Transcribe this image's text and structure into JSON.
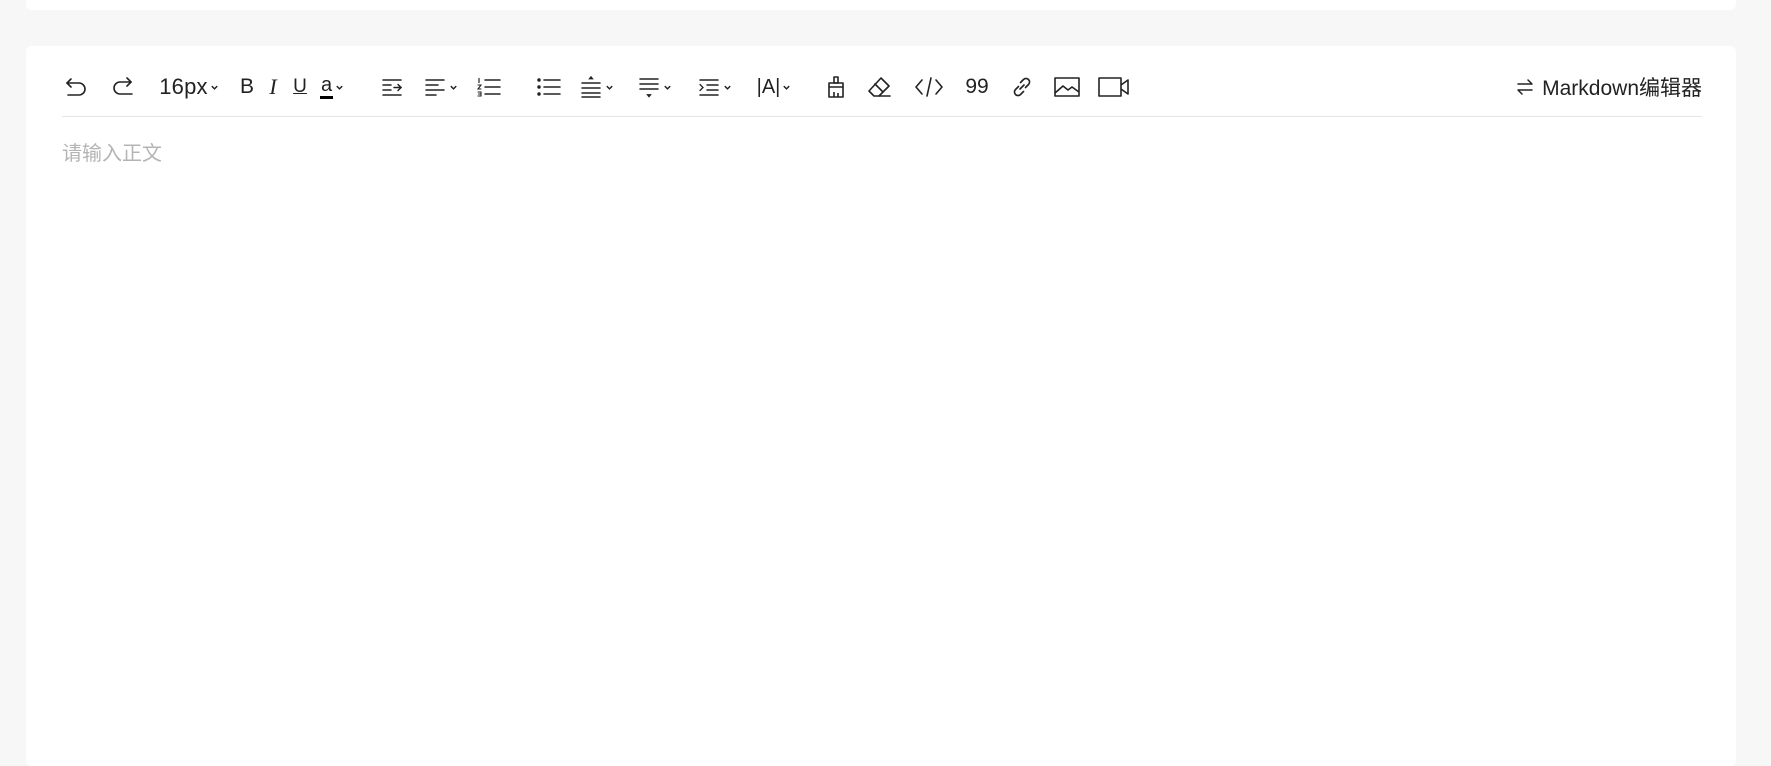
{
  "toolbar": {
    "font_size": "16px",
    "bold_label": "B",
    "italic_label": "I",
    "underline_label": "U",
    "font_color_label": "a",
    "letter_spacing_label": "|A|",
    "blockquote_label": "99",
    "icons": [
      "undo-icon",
      "redo-icon",
      "font-size-dropdown",
      "bold-icon",
      "italic-icon",
      "underline-icon",
      "font-color-icon",
      "indent-icon",
      "align-icon",
      "ordered-list-icon",
      "bullet-list-icon",
      "line-height-icon",
      "paragraph-spacing-icon",
      "first-line-indent-icon",
      "letter-spacing-icon",
      "format-painter-icon",
      "clear-format-icon",
      "code-icon",
      "blockquote-icon",
      "link-icon",
      "image-icon",
      "video-icon"
    ],
    "markdown_toggle_label": "Markdown编辑器"
  },
  "editor": {
    "placeholder": "请输入正文"
  },
  "colors": {
    "page_background": "#f7f7f7",
    "card_background": "#ffffff",
    "toolbar_divider": "#e6e6e6",
    "icon_color": "#222222",
    "placeholder_color": "#b4b4b4"
  }
}
